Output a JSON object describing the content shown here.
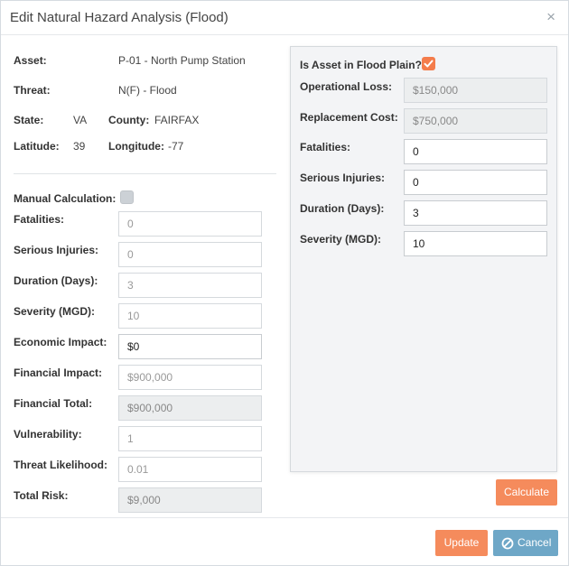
{
  "dialog": {
    "title": "Edit Natural Hazard Analysis (Flood)",
    "close_glyph": "×"
  },
  "asset_info": {
    "asset_label": "Asset:",
    "asset_value": "P-01 - North Pump Station",
    "threat_label": "Threat:",
    "threat_value": "N(F) - Flood",
    "state_label": "State:",
    "state_value": "VA",
    "county_label": "County:",
    "county_value": "FAIRFAX",
    "latitude_label": "Latitude:",
    "latitude_value": "39",
    "longitude_label": "Longitude:",
    "longitude_value": "-77"
  },
  "left_form": {
    "manual_calc_label": "Manual Calculation:",
    "manual_calc_checked": false,
    "fatalities": {
      "label": "Fatalities:",
      "value": "0"
    },
    "serious_injuries": {
      "label": "Serious Injuries:",
      "value": "0"
    },
    "duration": {
      "label": "Duration (Days):",
      "value": "3"
    },
    "severity": {
      "label": "Severity (MGD):",
      "value": "10"
    },
    "economic_impact": {
      "label": "Economic Impact:",
      "value": "$0"
    },
    "financial_impact": {
      "label": "Financial Impact:",
      "value": "$900,000"
    },
    "financial_total": {
      "label": "Financial Total:",
      "value": "$900,000"
    },
    "vulnerability": {
      "label": "Vulnerability:",
      "value": "1"
    },
    "threat_likelihood": {
      "label": "Threat Likelihood:",
      "value": "0.01"
    },
    "total_risk": {
      "label": "Total Risk:",
      "value": "$9,000"
    }
  },
  "flood_panel": {
    "flood_plain_label": "Is Asset in Flood Plain?",
    "flood_plain_checked": true,
    "operational_loss": {
      "label": "Operational Loss:",
      "value": "$150,000"
    },
    "replacement_cost": {
      "label": "Replacement Cost:",
      "value": "$750,000"
    },
    "fatalities": {
      "label": "Fatalities:",
      "value": "0"
    },
    "serious_injuries": {
      "label": "Serious Injuries:",
      "value": "0"
    },
    "duration": {
      "label": "Duration (Days):",
      "value": "3"
    },
    "severity": {
      "label": "Severity (MGD):",
      "value": "10"
    }
  },
  "buttons": {
    "calculate": "Calculate",
    "update": "Update",
    "cancel": "Cancel"
  },
  "colors": {
    "accent_orange": "#f58b5c",
    "checkbox_orange": "#f47c4b",
    "cancel_blue": "#6ea7c7"
  },
  "icons": {
    "close": "close-icon",
    "cancel": "cancel-circle-icon",
    "check": "check-icon"
  }
}
